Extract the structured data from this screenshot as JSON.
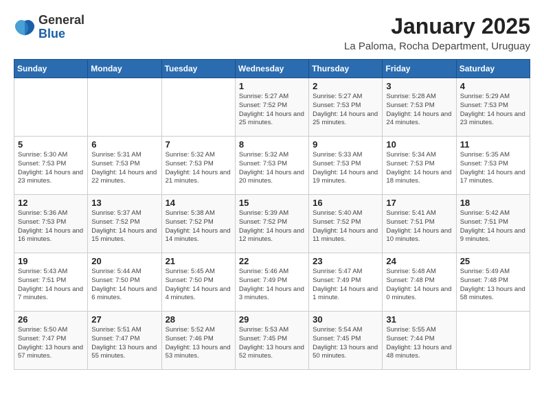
{
  "logo": {
    "general": "General",
    "blue": "Blue"
  },
  "title": "January 2025",
  "subtitle": "La Paloma, Rocha Department, Uruguay",
  "headers": [
    "Sunday",
    "Monday",
    "Tuesday",
    "Wednesday",
    "Thursday",
    "Friday",
    "Saturday"
  ],
  "weeks": [
    [
      {
        "day": "",
        "info": ""
      },
      {
        "day": "",
        "info": ""
      },
      {
        "day": "",
        "info": ""
      },
      {
        "day": "1",
        "info": "Sunrise: 5:27 AM\nSunset: 7:52 PM\nDaylight: 14 hours\nand 25 minutes."
      },
      {
        "day": "2",
        "info": "Sunrise: 5:27 AM\nSunset: 7:53 PM\nDaylight: 14 hours\nand 25 minutes."
      },
      {
        "day": "3",
        "info": "Sunrise: 5:28 AM\nSunset: 7:53 PM\nDaylight: 14 hours\nand 24 minutes."
      },
      {
        "day": "4",
        "info": "Sunrise: 5:29 AM\nSunset: 7:53 PM\nDaylight: 14 hours\nand 23 minutes."
      }
    ],
    [
      {
        "day": "5",
        "info": "Sunrise: 5:30 AM\nSunset: 7:53 PM\nDaylight: 14 hours\nand 23 minutes."
      },
      {
        "day": "6",
        "info": "Sunrise: 5:31 AM\nSunset: 7:53 PM\nDaylight: 14 hours\nand 22 minutes."
      },
      {
        "day": "7",
        "info": "Sunrise: 5:32 AM\nSunset: 7:53 PM\nDaylight: 14 hours\nand 21 minutes."
      },
      {
        "day": "8",
        "info": "Sunrise: 5:32 AM\nSunset: 7:53 PM\nDaylight: 14 hours\nand 20 minutes."
      },
      {
        "day": "9",
        "info": "Sunrise: 5:33 AM\nSunset: 7:53 PM\nDaylight: 14 hours\nand 19 minutes."
      },
      {
        "day": "10",
        "info": "Sunrise: 5:34 AM\nSunset: 7:53 PM\nDaylight: 14 hours\nand 18 minutes."
      },
      {
        "day": "11",
        "info": "Sunrise: 5:35 AM\nSunset: 7:53 PM\nDaylight: 14 hours\nand 17 minutes."
      }
    ],
    [
      {
        "day": "12",
        "info": "Sunrise: 5:36 AM\nSunset: 7:53 PM\nDaylight: 14 hours\nand 16 minutes."
      },
      {
        "day": "13",
        "info": "Sunrise: 5:37 AM\nSunset: 7:52 PM\nDaylight: 14 hours\nand 15 minutes."
      },
      {
        "day": "14",
        "info": "Sunrise: 5:38 AM\nSunset: 7:52 PM\nDaylight: 14 hours\nand 14 minutes."
      },
      {
        "day": "15",
        "info": "Sunrise: 5:39 AM\nSunset: 7:52 PM\nDaylight: 14 hours\nand 12 minutes."
      },
      {
        "day": "16",
        "info": "Sunrise: 5:40 AM\nSunset: 7:52 PM\nDaylight: 14 hours\nand 11 minutes."
      },
      {
        "day": "17",
        "info": "Sunrise: 5:41 AM\nSunset: 7:51 PM\nDaylight: 14 hours\nand 10 minutes."
      },
      {
        "day": "18",
        "info": "Sunrise: 5:42 AM\nSunset: 7:51 PM\nDaylight: 14 hours\nand 9 minutes."
      }
    ],
    [
      {
        "day": "19",
        "info": "Sunrise: 5:43 AM\nSunset: 7:51 PM\nDaylight: 14 hours\nand 7 minutes."
      },
      {
        "day": "20",
        "info": "Sunrise: 5:44 AM\nSunset: 7:50 PM\nDaylight: 14 hours\nand 6 minutes."
      },
      {
        "day": "21",
        "info": "Sunrise: 5:45 AM\nSunset: 7:50 PM\nDaylight: 14 hours\nand 4 minutes."
      },
      {
        "day": "22",
        "info": "Sunrise: 5:46 AM\nSunset: 7:49 PM\nDaylight: 14 hours\nand 3 minutes."
      },
      {
        "day": "23",
        "info": "Sunrise: 5:47 AM\nSunset: 7:49 PM\nDaylight: 14 hours\nand 1 minute."
      },
      {
        "day": "24",
        "info": "Sunrise: 5:48 AM\nSunset: 7:48 PM\nDaylight: 14 hours\nand 0 minutes."
      },
      {
        "day": "25",
        "info": "Sunrise: 5:49 AM\nSunset: 7:48 PM\nDaylight: 13 hours\nand 58 minutes."
      }
    ],
    [
      {
        "day": "26",
        "info": "Sunrise: 5:50 AM\nSunset: 7:47 PM\nDaylight: 13 hours\nand 57 minutes."
      },
      {
        "day": "27",
        "info": "Sunrise: 5:51 AM\nSunset: 7:47 PM\nDaylight: 13 hours\nand 55 minutes."
      },
      {
        "day": "28",
        "info": "Sunrise: 5:52 AM\nSunset: 7:46 PM\nDaylight: 13 hours\nand 53 minutes."
      },
      {
        "day": "29",
        "info": "Sunrise: 5:53 AM\nSunset: 7:45 PM\nDaylight: 13 hours\nand 52 minutes."
      },
      {
        "day": "30",
        "info": "Sunrise: 5:54 AM\nSunset: 7:45 PM\nDaylight: 13 hours\nand 50 minutes."
      },
      {
        "day": "31",
        "info": "Sunrise: 5:55 AM\nSunset: 7:44 PM\nDaylight: 13 hours\nand 48 minutes."
      },
      {
        "day": "",
        "info": ""
      }
    ]
  ]
}
